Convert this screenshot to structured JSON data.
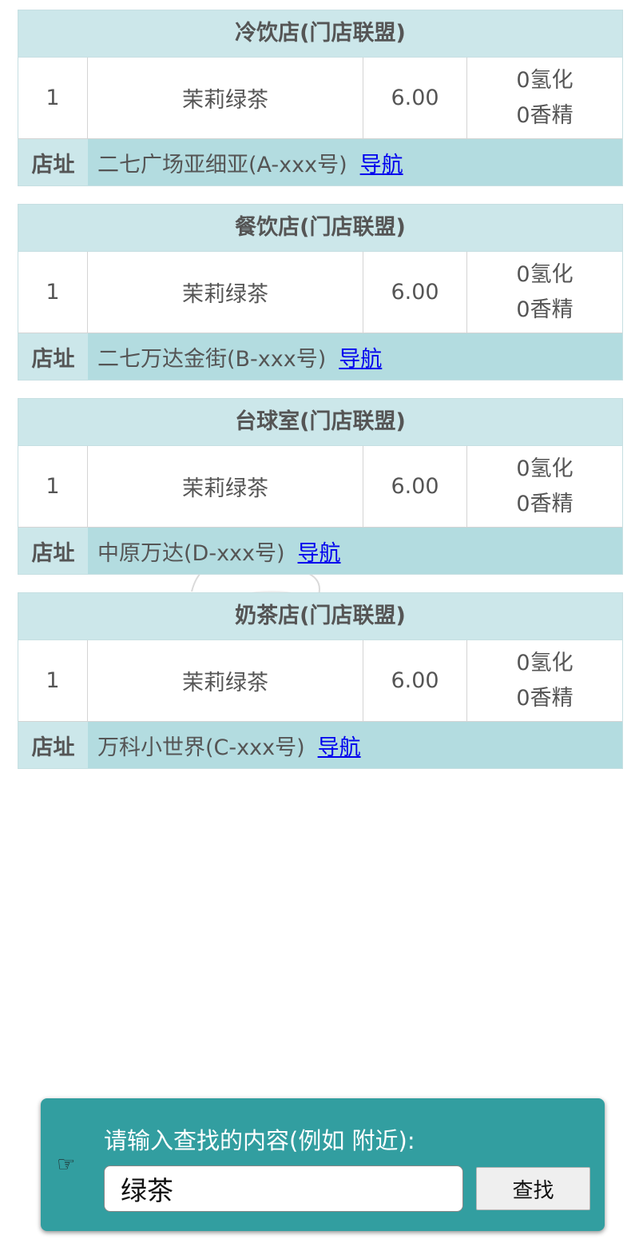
{
  "stores": [
    {
      "title": "冷饮店(门店联盟)",
      "qty": "1",
      "item": "茉莉绿茶",
      "price": "6.00",
      "tag1": "0氢化",
      "tag2": "0香精",
      "address_label": "店址",
      "address": "二七广场亚细亚(A-xxx号)",
      "nav": "导航"
    },
    {
      "title": "餐饮店(门店联盟)",
      "qty": "1",
      "item": "茉莉绿茶",
      "price": "6.00",
      "tag1": "0氢化",
      "tag2": "0香精",
      "address_label": "店址",
      "address": "二七万达金街(B-xxx号)",
      "nav": "导航"
    },
    {
      "title": "台球室(门店联盟)",
      "qty": "1",
      "item": "茉莉绿茶",
      "price": "6.00",
      "tag1": "0氢化",
      "tag2": "0香精",
      "address_label": "店址",
      "address": "中原万达(D-xxx号)",
      "nav": "导航"
    },
    {
      "title": "奶茶店(门店联盟)",
      "qty": "1",
      "item": "茉莉绿茶",
      "price": "6.00",
      "tag1": "0氢化",
      "tag2": "0香精",
      "address_label": "店址",
      "address": "万科小世界(C-xxx号)",
      "nav": "导航"
    }
  ],
  "search": {
    "hand_icon": "☞",
    "label": "请输入查找的内容(例如 附近):",
    "value": "绿茶",
    "button": "查找"
  },
  "colors": {
    "header_bg": "#cce7ea",
    "address_bg": "#b3dce0",
    "panel_bg": "#329ea0",
    "link": "#0000ee"
  }
}
